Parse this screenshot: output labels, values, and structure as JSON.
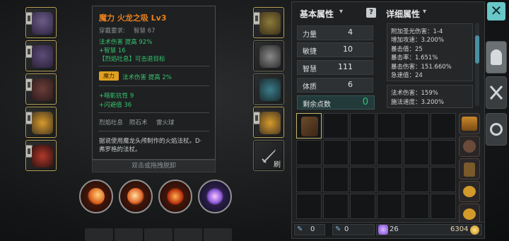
{
  "tooltip": {
    "title": "魔力 火龙之吸 Lv3",
    "requirement_label": "穿戴要求:",
    "requirement_value": "智慧 67",
    "lines_a": [
      "法术伤害 提高 92%",
      "+智慧 16",
      "【烈焰吐息】可击退目标"
    ],
    "enchant_tag": "魔力",
    "enchant_text": "法术伤害 提高 2%",
    "lines_b": [
      "+暗影抗性 9",
      "+闪避值 36"
    ],
    "skill_names": [
      "烈焰吐息",
      "陨石术",
      "雷火球"
    ],
    "description_1": "据说使用魔龙头颅制作的火焰法杖。D·",
    "description_2": "弗罗格的法杖。",
    "footer_hint": "双击或拖拽脱卸"
  },
  "left_slot_label": "刷",
  "basic": {
    "header": "基本属性",
    "stats": [
      {
        "name": "力量",
        "value": "4"
      },
      {
        "name": "敏捷",
        "value": "10"
      },
      {
        "name": "智慧",
        "value": "111"
      },
      {
        "name": "体质",
        "value": "6"
      }
    ],
    "remaining_label": "剩余点数",
    "remaining_value": "0"
  },
  "detail": {
    "header": "详细属性",
    "lines_1": [
      "附加圣光伤害：1-4",
      "增加攻速：3.200%",
      "暴击值：25",
      "暴击率：1.651%",
      "暴击伤害：151.660%",
      "急速值：24"
    ],
    "lines_2": [
      "法术伤害：159%",
      "施法速度：3.200%"
    ]
  },
  "footer": {
    "stat_1": "0",
    "stat_2": "0",
    "gems": "26",
    "gold": "6304"
  },
  "icons": {
    "close": "close-icon",
    "helmet_tab": "helmet-icon",
    "swords_tab": "crossed-swords-icon",
    "gear_tab": "gear-icon",
    "help": "help-icon"
  },
  "colors": {
    "title_orange": "#e8801e",
    "green_value": "#35c46e",
    "accent_teal": "#69c7c8",
    "gold": "#e0b040"
  }
}
